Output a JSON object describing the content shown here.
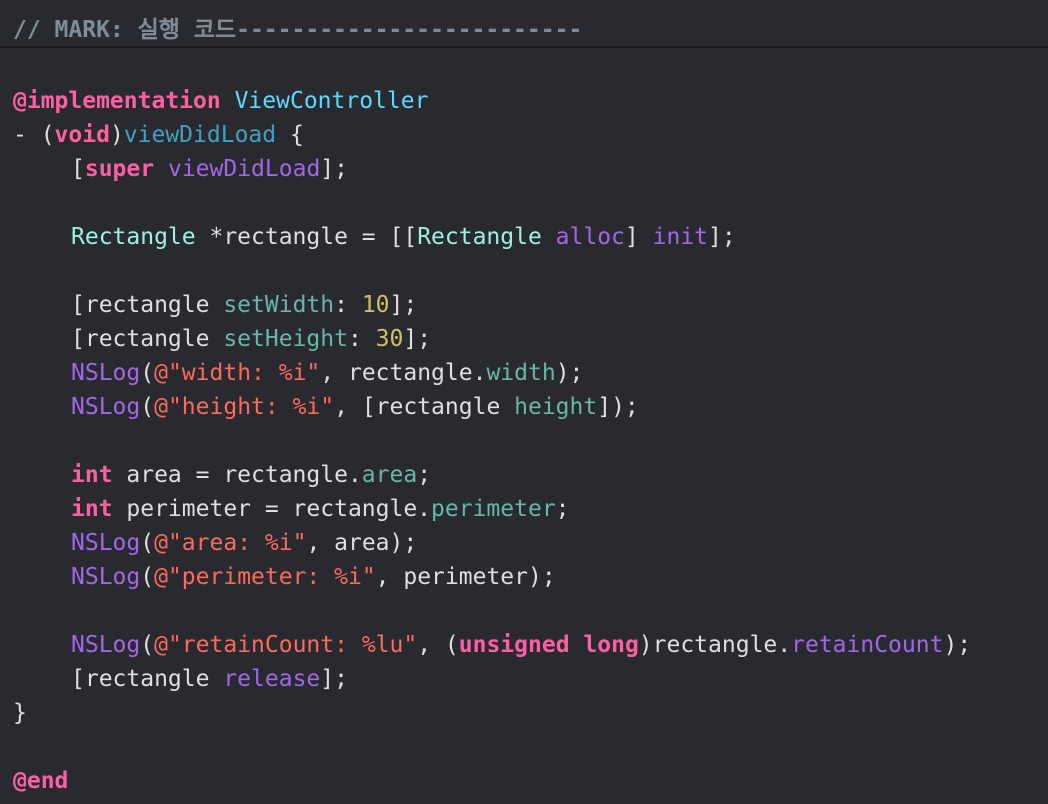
{
  "header": {
    "mark_comment": "// MARK: 실행 코드-------------------------"
  },
  "code": {
    "l1": {
      "directive": "@implementation",
      "class_name": "ViewController"
    },
    "l2": {
      "prefix": "- (",
      "ret_type": "void",
      "close": ")",
      "method": "viewDidLoad",
      "brace": " {"
    },
    "l3": {
      "open": "[",
      "super_kw": "super",
      "sp": " ",
      "msg": "viewDidLoad",
      "close": "];"
    },
    "l5": {
      "type": "Rectangle",
      "decl": " *rectangle = [[",
      "cls": "Rectangle",
      "sp1": " ",
      "alloc": "alloc",
      "mid": "] ",
      "init": "init",
      "end": "];"
    },
    "l7": {
      "open": "[rectangle ",
      "msg": "setWidth",
      "colon": ": ",
      "num": "10",
      "end": "];"
    },
    "l8": {
      "open": "[rectangle ",
      "msg": "setHeight",
      "colon": ": ",
      "num": "30",
      "end": "];"
    },
    "l9": {
      "fn": "NSLog",
      "open": "(",
      "str": "@\"width: %i\"",
      "mid": ", rectangle.",
      "prop": "width",
      "end": ");"
    },
    "l10": {
      "fn": "NSLog",
      "open": "(",
      "str": "@\"height: %i\"",
      "mid": ", [rectangle ",
      "prop": "height",
      "end": "]);"
    },
    "l12": {
      "kw": "int",
      "mid": " area = rectangle.",
      "prop": "area",
      "end": ";"
    },
    "l13": {
      "kw": "int",
      "mid": " perimeter = rectangle.",
      "prop": "perimeter",
      "end": ";"
    },
    "l14": {
      "fn": "NSLog",
      "open": "(",
      "str": "@\"area: %i\"",
      "end": ", area);"
    },
    "l15": {
      "fn": "NSLog",
      "open": "(",
      "str": "@\"perimeter: %i\"",
      "end": ", perimeter);"
    },
    "l17": {
      "fn": "NSLog",
      "open": "(",
      "str": "@\"retainCount: %lu\"",
      "mid": ", (",
      "kw1": "unsigned",
      "sp": " ",
      "kw2": "long",
      "mid2": ")rectangle.",
      "meth": "retainCount",
      "end": ");"
    },
    "l18": {
      "open": "[rectangle ",
      "msg": "release",
      "end": "];"
    },
    "l19": {
      "brace": "}"
    },
    "l21": {
      "directive": "@end"
    }
  },
  "colors": {
    "background": "#292a30",
    "keyword": "#fc5fa3",
    "class": "#5dd8ff",
    "type": "#9ef1dd",
    "method_decl": "#41a1c0",
    "method_call": "#a167e6",
    "property": "#67b7a4",
    "string": "#fc6a5d",
    "number": "#d0bf69",
    "comment": "#7f8c98",
    "plain": "#dfdfe0"
  }
}
